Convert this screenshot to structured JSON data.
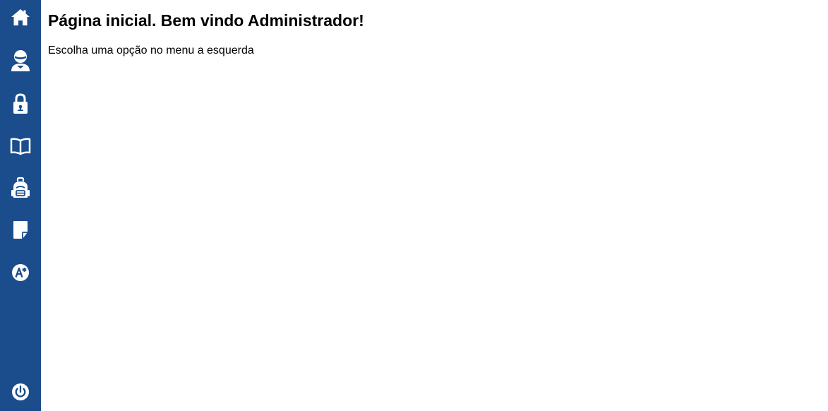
{
  "colors": {
    "sidebar_bg": "#1b4d8c",
    "icon": "#ffffff",
    "background": "#ffffff",
    "text": "#000000"
  },
  "sidebar": {
    "items": [
      {
        "icon": "home-icon"
      },
      {
        "icon": "user-icon"
      },
      {
        "icon": "lock-icon"
      },
      {
        "icon": "book-icon"
      },
      {
        "icon": "backpack-icon"
      },
      {
        "icon": "note-icon"
      },
      {
        "icon": "grade-icon"
      }
    ],
    "logout": {
      "icon": "power-icon"
    }
  },
  "main": {
    "title": "Página inicial. Bem vindo Administrador!",
    "subtitle": "Escolha uma opção no menu a esquerda"
  }
}
